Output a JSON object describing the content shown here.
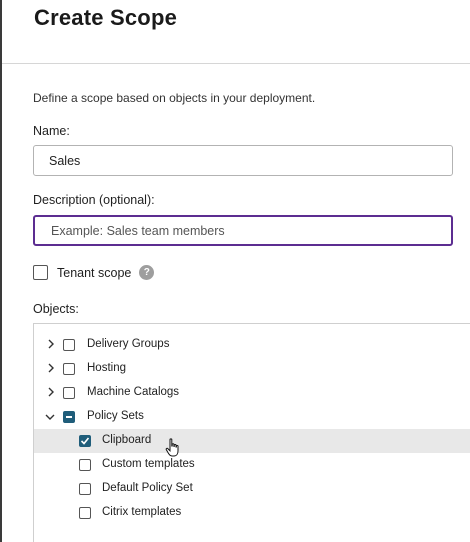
{
  "dialog": {
    "title": "Create Scope",
    "intro": "Define a scope based on objects in your deployment."
  },
  "form": {
    "name_label": "Name:",
    "name_value": "Sales",
    "description_label": "Description (optional):",
    "description_placeholder": "Example: Sales team members",
    "description_value": "",
    "tenant_scope_label": "Tenant scope",
    "tenant_scope_checked": false,
    "help_icon": "?"
  },
  "objects": {
    "label": "Objects:",
    "items": [
      {
        "label": "Delivery Groups",
        "expanded": false,
        "checked": false
      },
      {
        "label": "Hosting",
        "expanded": false,
        "checked": false
      },
      {
        "label": "Machine Catalogs",
        "expanded": false,
        "checked": false
      },
      {
        "label": "Policy Sets",
        "expanded": true,
        "checked": "partial"
      },
      {
        "label": "Clipboard",
        "checked": true,
        "selected": true,
        "child": true
      },
      {
        "label": "Custom templates",
        "checked": false,
        "child": true
      },
      {
        "label": "Default Policy Set",
        "checked": false,
        "child": true
      },
      {
        "label": "Citrix templates",
        "checked": false,
        "child": true
      }
    ]
  },
  "colors": {
    "accent_focus": "#5c2d91",
    "checkbox_checked": "#1f5d7a",
    "selected_row": "#e8e8e8"
  },
  "icons": {
    "collapsed": "chevron-right-icon",
    "expanded": "chevron-down-icon",
    "help": "help-icon",
    "cursor": "hand-pointer-icon"
  }
}
